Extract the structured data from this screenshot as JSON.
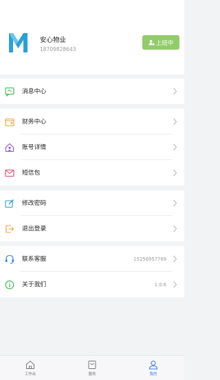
{
  "profile": {
    "name": "安心物业",
    "phone": "18709828643",
    "shift_button": "上班中"
  },
  "colors": {
    "accent": "#3c7ee8",
    "shift_button": "#92cc6a",
    "logo": "#2aa0d8"
  },
  "menu": [
    {
      "label": "消息中心",
      "icon": "message-icon",
      "value": ""
    },
    {
      "label": "财务中心",
      "icon": "wallet-icon",
      "value": ""
    },
    {
      "label": "账号详情",
      "icon": "account-icon",
      "value": ""
    },
    {
      "label": "短信包",
      "icon": "sms-icon",
      "value": ""
    },
    {
      "label": "修改密码",
      "icon": "edit-password-icon",
      "value": ""
    },
    {
      "label": "退出登录",
      "icon": "logout-icon",
      "value": ""
    },
    {
      "label": "联系客服",
      "icon": "headset-icon",
      "value": "15256957769"
    },
    {
      "label": "关于我们",
      "icon": "info-icon",
      "value": "1.0.6"
    }
  ],
  "tabs": [
    {
      "label": "工作台",
      "icon": "home-icon"
    },
    {
      "label": "服务",
      "icon": "service-icon"
    },
    {
      "label": "我的",
      "icon": "user-icon"
    }
  ]
}
